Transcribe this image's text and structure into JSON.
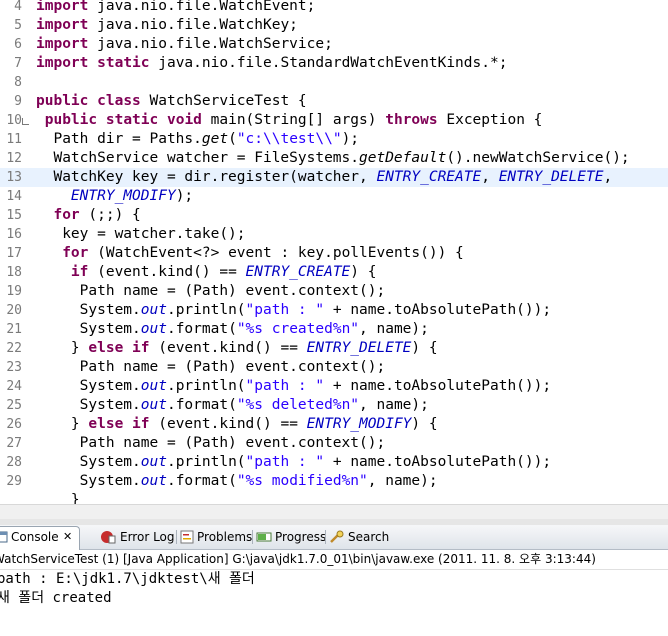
{
  "editor": {
    "lines": [
      {
        "n": "4",
        "t": "import java.nio.file.WatchEvent;"
      },
      {
        "n": "5",
        "t": "import java.nio.file.WatchKey;"
      },
      {
        "n": "6",
        "t": "import java.nio.file.WatchService;"
      },
      {
        "n": "7",
        "t": "import static java.nio.file.StandardWatchEventKinds.*;"
      },
      {
        "n": "8",
        "t": ""
      },
      {
        "n": "9",
        "t": "public class WatchServiceTest {"
      },
      {
        "n": "10",
        "t": " public static void main(String[] args) throws Exception {"
      },
      {
        "n": "11",
        "t": "  Path dir = Paths.get(\"c:\\\\test\\\\\");"
      },
      {
        "n": "12",
        "t": "  WatchService watcher = FileSystems.getDefault().newWatchService();"
      },
      {
        "n": "13",
        "t": "  WatchKey key = dir.register(watcher, ENTRY_CREATE, ENTRY_DELETE,"
      },
      {
        "n": "14",
        "t": "    ENTRY_MODIFY);"
      },
      {
        "n": "15",
        "t": "  for (;;) {"
      },
      {
        "n": "16",
        "t": "   key = watcher.take();"
      },
      {
        "n": "17",
        "t": "   for (WatchEvent<?> event : key.pollEvents()) {"
      },
      {
        "n": "18",
        "t": "    if (event.kind() == ENTRY_CREATE) {"
      },
      {
        "n": "19",
        "t": "     Path name = (Path) event.context();"
      },
      {
        "n": "20",
        "t": "     System.out.println(\"path : \" + name.toAbsolutePath());"
      },
      {
        "n": "21",
        "t": "     System.out.format(\"%s created%n\", name);"
      },
      {
        "n": "22",
        "t": "    } else if (event.kind() == ENTRY_DELETE) {"
      },
      {
        "n": "23",
        "t": "     Path name = (Path) event.context();"
      },
      {
        "n": "24",
        "t": "     System.out.println(\"path : \" + name.toAbsolutePath());"
      },
      {
        "n": "25",
        "t": "     System.out.format(\"%s deleted%n\", name);"
      },
      {
        "n": "26",
        "t": "    } else if (event.kind() == ENTRY_MODIFY) {"
      },
      {
        "n": "27",
        "t": "     Path name = (Path) event.context();"
      },
      {
        "n": "28",
        "t": "     System.out.println(\"path : \" + name.toAbsolutePath());"
      },
      {
        "n": "29",
        "t": "     System.out.format(\"%s modified%n\", name);"
      },
      {
        "n": "",
        "t": "    }"
      }
    ]
  },
  "tabs": [
    {
      "label": "Console",
      "icon": "console-icon",
      "close": "✕"
    },
    {
      "label": "Error Log",
      "icon": "error-log-icon"
    },
    {
      "label": "Problems",
      "icon": "problems-icon"
    },
    {
      "label": "Progress",
      "icon": "progress-icon"
    },
    {
      "label": "Search",
      "icon": "search-icon"
    }
  ],
  "console": {
    "description": "WatchServiceTest (1) [Java Application] G:\\java\\jdk1.7.0_01\\bin\\javaw.exe (2011. 11. 8. 오후 3:13:44)",
    "output": [
      "path : E:\\jdk1.7\\jdktest\\새 폴더",
      "새 폴더 created"
    ]
  },
  "colors": {
    "keyword": "#7f0055",
    "string": "#2a00ff",
    "static_field": "#0000c0",
    "current_line": "#e8f2fe"
  }
}
